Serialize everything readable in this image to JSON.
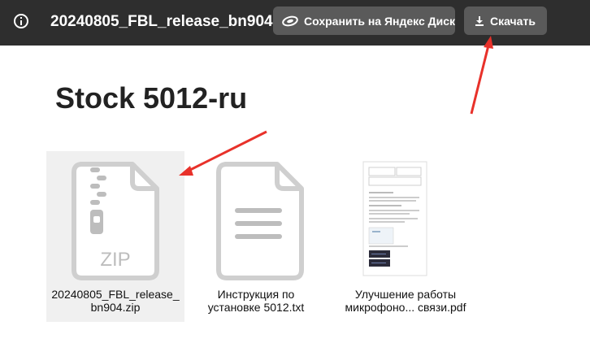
{
  "header": {
    "title": "20240805_FBL_release_bn904...",
    "save_label": "Сохранить на Яндекс Диск",
    "download_label": "Скачать"
  },
  "folder": {
    "name": "Stock 5012-ru"
  },
  "files": [
    {
      "line1": "20240805_FBL_release_",
      "line2": "bn904.zip",
      "icon": "zip-icon",
      "badge": "ZIP"
    },
    {
      "line1": "Инструкция по",
      "line2": "установке 5012.txt",
      "icon": "text-file-icon"
    },
    {
      "line1": "Улучшение работы",
      "line2": "микрофоно... связи.pdf",
      "icon": "pdf-thumbnail"
    }
  ],
  "colors": {
    "topbar": "#2e2e2e",
    "button": "#5a5a5a",
    "annotation_arrow": "#e8312a",
    "icon_gray": "#cfcfcf"
  }
}
